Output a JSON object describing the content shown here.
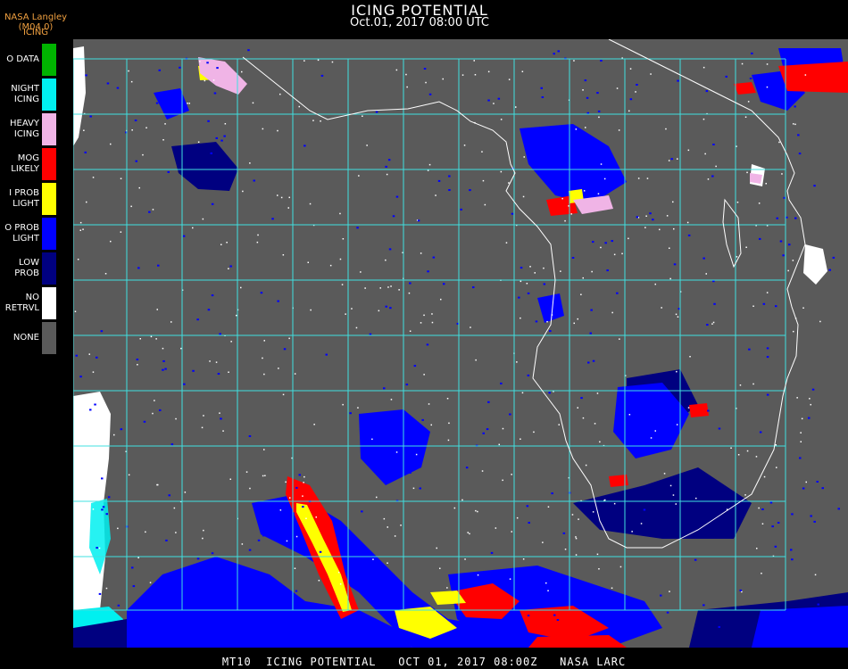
{
  "header": {
    "producer": "NASA Langley (M04.0)",
    "product": "ICING",
    "title": "ICING POTENTIAL",
    "datetime": "Oct.01, 2017 08:00 UTC"
  },
  "legend": [
    {
      "label": "O DATA",
      "color": "#00b400"
    },
    {
      "label": "NIGHT\nICING",
      "color": "#00f0f0"
    },
    {
      "label": "HEAVY\nICING",
      "color": "#f0b4e6"
    },
    {
      "label": "MOG\nLIKELY",
      "color": "#ff0000"
    },
    {
      "label": "I PROB\nLIGHT",
      "color": "#ffff00"
    },
    {
      "label": "O PROB\nLIGHT",
      "color": "#0000ff"
    },
    {
      "label": "LOW\nPROB",
      "color": "#000080"
    },
    {
      "label": "NO\nRETRVL",
      "color": "#ffffff"
    },
    {
      "label": "NONE",
      "color": "#5a5a5a"
    }
  ],
  "map_colors": {
    "background": "#5a5a5a",
    "grid": "#40e0e0",
    "coast": "#ffffff",
    "grid_label": "#c00000"
  },
  "footer": "MT10  ICING POTENTIAL   OCT 01, 2017 08:00Z   NASA LARC"
}
